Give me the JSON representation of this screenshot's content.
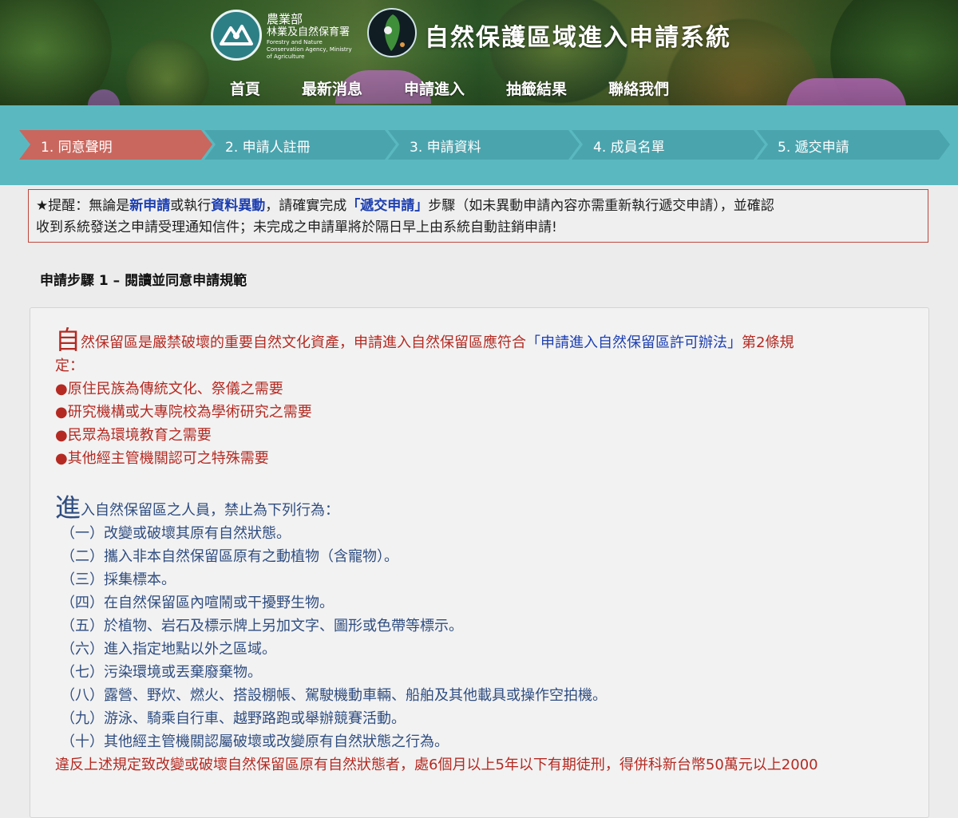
{
  "header": {
    "agency_name_1": "農業部",
    "agency_name_2": "林業及自然保育署",
    "agency_en": "Forestry and Nature Conservation Agency, Ministry of Agriculture",
    "site_title": "自然保護區域進入申請系統"
  },
  "nav": {
    "items": [
      "首頁",
      "最新消息",
      "申請進入",
      "抽籤結果",
      "聯絡我們"
    ]
  },
  "steps": {
    "items": [
      "1. 同意聲明",
      "2. 申請人註冊",
      "3. 申請資料",
      "4. 成員名單",
      "5. 遞交申請"
    ],
    "active_index": 0,
    "colors": {
      "active": "#c9675e",
      "inactive": "#4aa4ae",
      "band": "#5ab9c0"
    }
  },
  "notice": {
    "prefix": "★提醒：無論是",
    "new_app": "新申請",
    "or_exec": "或執行",
    "data_change": "資料異動",
    "please_complete": "，請確實完成",
    "submit_step": "「遞交申請」",
    "rest_line1": "步驟（如未異動申請內容亦需重新執行遞交申請），並確認",
    "line2": "收到系統發送之申請受理通知信件；未完成之申請單將於隔日早上由系統自動註銷申請!"
  },
  "step_heading": "申請步驟 1 – 閱讀並同意申請規範",
  "content": {
    "p1_big": "自",
    "p1_text": "然保留區是嚴禁破壞的重要自然文化資產，申請進入自然保留區應符合",
    "p1_link": "「申請進入自然保留區許可辦法」",
    "p1_text2": "第2條規",
    "p1_line2": "定：",
    "bullets": [
      "●原住民族為傳統文化、祭儀之需要",
      "●研究機構或大專院校為學術研究之需要",
      "●民眾為環境教育之需要",
      "●其他經主管機關認可之特殊需要"
    ],
    "p2_big": "進",
    "p2_text": "入自然保留區之人員，禁止為下列行為：",
    "prohibitions": [
      "（一）改變或破壞其原有自然狀態。",
      "（二）攜入非本自然保留區原有之動植物（含寵物）。",
      "（三）採集標本。",
      "（四）在自然保留區內喧鬧或干擾野生物。",
      "（五）於植物、岩石及標示牌上另加文字、圖形或色帶等標示。",
      "（六）進入指定地點以外之區域。",
      "（七）污染環境或丟棄廢棄物。",
      "（八）露營、野炊、燃火、搭設棚帳、駕駛機動車輛、船舶及其他載具或操作空拍機。",
      "（九）游泳、騎乘自行車、越野路跑或舉辦競賽活動。",
      "（十）其他經主管機關認屬破壞或改變原有自然狀態之行為。"
    ],
    "penalty": "違反上述規定致改變或破壞自然保留區原有自然狀態者，處6個月以上5年以下有期徒刑，得併科新台幣50萬元以上2000"
  }
}
